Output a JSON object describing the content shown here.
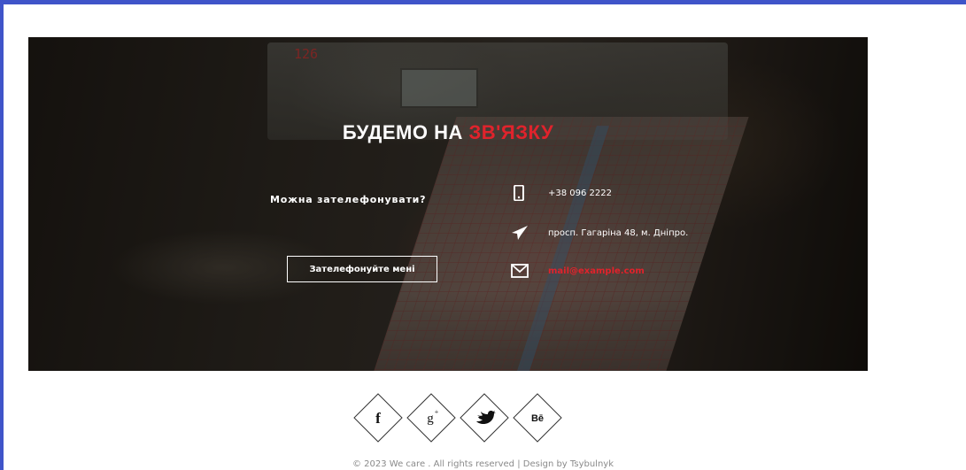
{
  "hero": {
    "title_prefix": "БУДЕМО НА",
    "title_accent": "ЗВ'ЯЗКУ",
    "question": "Можна зателефонувати?",
    "call_button_label": "Зателефонуйте мені",
    "device_readout": "126"
  },
  "contacts": [
    {
      "icon": "phone-icon",
      "text": "+38 096 2222"
    },
    {
      "icon": "paper-plane-icon",
      "text": "просп. Гагаріна 48, м. Дніпро."
    },
    {
      "icon": "envelope-icon",
      "text": "mail@example.com"
    }
  ],
  "social": [
    {
      "icon": "facebook-icon",
      "label": "f"
    },
    {
      "icon": "google-plus-icon",
      "label": "g+"
    },
    {
      "icon": "twitter-icon",
      "label": ""
    },
    {
      "icon": "behance-icon",
      "label": "Bē"
    }
  ],
  "footer": {
    "copyright": "© 2023 We care . All rights reserved | Design by Tsybulnyk"
  },
  "colors": {
    "accent": "#e0232c",
    "frame": "#3f54c9",
    "text_light": "#ffffff",
    "footer_text": "#8a8a8a"
  }
}
